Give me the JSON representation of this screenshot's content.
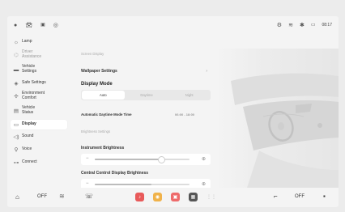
{
  "status_bar": {
    "time": "08:17",
    "left_icons": [
      "dots-icon",
      "car-door-icon",
      "camera-icon",
      "ring-icon"
    ],
    "right_icons": [
      "settings-icon",
      "wifi-icon",
      "bluetooth-icon",
      "battery-icon"
    ]
  },
  "sidebar": {
    "items": [
      {
        "label": "Lamp",
        "icon": "lamp-icon",
        "dim": false,
        "active": false
      },
      {
        "label": "Driver Assistance",
        "icon": "driver-assist-icon",
        "dim": true,
        "active": false
      },
      {
        "label": "Vehicle Settings",
        "icon": "vehicle-icon",
        "dim": false,
        "active": false
      },
      {
        "label": "Safe Settings",
        "icon": "shield-icon",
        "dim": false,
        "active": false
      },
      {
        "label": "Environment Comfort",
        "icon": "fan-icon",
        "dim": false,
        "active": false
      },
      {
        "label": "Vehicle Status",
        "icon": "status-icon",
        "dim": false,
        "active": false
      },
      {
        "label": "Display",
        "icon": "display-icon",
        "dim": false,
        "active": true
      },
      {
        "label": "Sound",
        "icon": "sound-icon",
        "dim": false,
        "active": false
      },
      {
        "label": "Voice",
        "icon": "voice-icon",
        "dim": false,
        "active": false
      },
      {
        "label": "Connect",
        "icon": "connect-icon",
        "dim": false,
        "active": false
      }
    ]
  },
  "content": {
    "screen_display": "Screen Display",
    "wallpaper_settings": "Wallpaper Settings",
    "display_mode": "Display Mode",
    "modes": [
      "Auto",
      "Daytime",
      "Night"
    ],
    "selected_mode": "Auto",
    "auto_daytime_label": "Automatic Daytime Mode Time",
    "auto_daytime_value": "06:00 - 18:00",
    "brightness_settings": "Brightness Settings",
    "instrument_brightness": "Instrument Brightness",
    "instrument_brightness_value": 0.7,
    "central_brightness": "Central Control Display Brightness",
    "central_brightness_value": 0.6
  },
  "dock": {
    "left_label": "OFF",
    "right_label": "OFF"
  },
  "colors": {
    "app_red": "#e85a5a",
    "app_yellow": "#f0b24a",
    "app_pink": "#ee6b6b",
    "app_gray": "#555555"
  }
}
